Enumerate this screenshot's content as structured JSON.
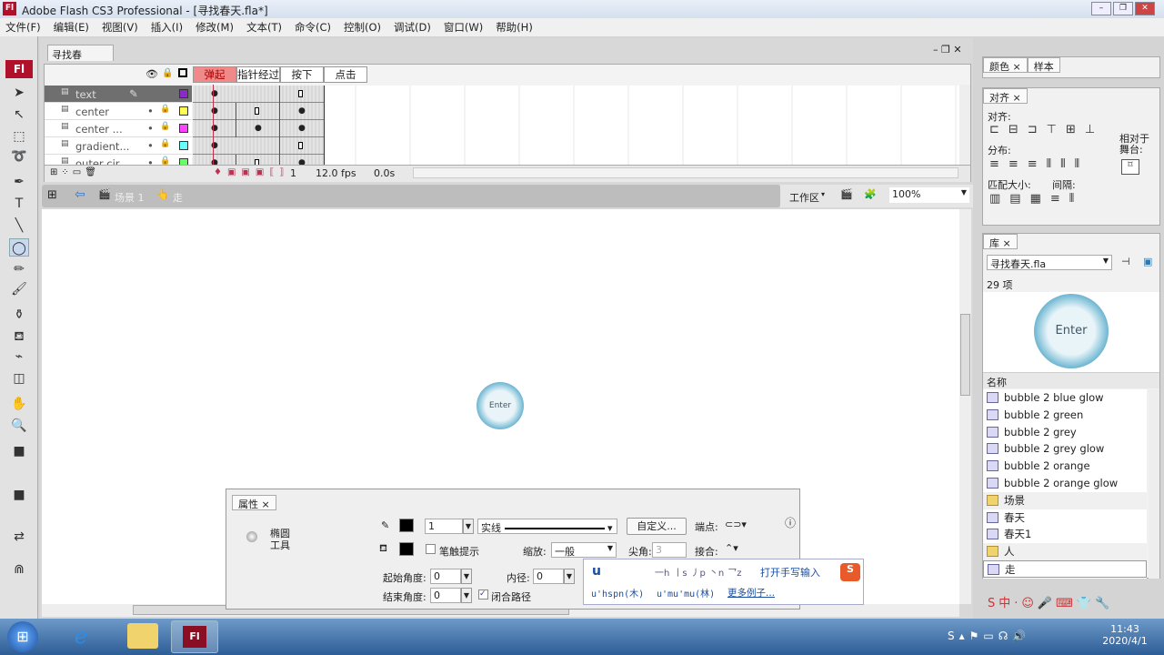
{
  "window": {
    "title": "Adobe Flash CS3 Professional - [寻找春天.fla*]",
    "logo": "Fl",
    "min": "–",
    "max": "❐",
    "close": "✕"
  },
  "menu": [
    "文件(F)",
    "编辑(E)",
    "视图(V)",
    "插入(I)",
    "修改(M)",
    "文本(T)",
    "命令(C)",
    "控制(O)",
    "调试(D)",
    "窗口(W)",
    "帮助(H)"
  ],
  "document": {
    "tab": "寻找春天.fla*"
  },
  "timeline": {
    "frame_labels": [
      "弹起",
      "指针经过",
      "按下",
      "点击"
    ],
    "layers": [
      {
        "name": "text",
        "color": "#8a2bc8"
      },
      {
        "name": "center",
        "color": "#ffff55"
      },
      {
        "name": "center ...",
        "color": "#ff44ff"
      },
      {
        "name": "gradient...",
        "color": "#66ffff"
      },
      {
        "name": "outer cir...",
        "color": "#66ff66"
      }
    ],
    "current_frame": "1",
    "fps": "12.0 fps",
    "time": "0.0s"
  },
  "editbar": {
    "scene": "场景 1",
    "symbol": "走",
    "workspace": "工作区",
    "zoom": "100%"
  },
  "stage": {
    "symbol_text": "Enter"
  },
  "panels": {
    "color": {
      "tabs": [
        "颜色",
        "样本"
      ]
    },
    "align": {
      "tab": "对齐",
      "align_label": "对齐:",
      "distribute_label": "分布:",
      "match_label": "匹配大小:",
      "space_label": "间隔:",
      "relative_label": "相对于舞台:"
    },
    "library": {
      "tab": "库",
      "file": "寻找春天.fla",
      "count": "29 项",
      "preview_text": "Enter",
      "column": "名称",
      "items": [
        {
          "name": "bubble 2 blue glow",
          "type": "symbol"
        },
        {
          "name": "bubble 2 green",
          "type": "button"
        },
        {
          "name": "bubble 2 grey",
          "type": "button"
        },
        {
          "name": "bubble 2 grey glow",
          "type": "button"
        },
        {
          "name": "bubble 2 orange",
          "type": "button"
        },
        {
          "name": "bubble 2 orange glow",
          "type": "symbol"
        },
        {
          "name": "场景",
          "type": "folder"
        },
        {
          "name": "春天",
          "type": "symbol"
        },
        {
          "name": "春天1",
          "type": "symbol"
        },
        {
          "name": "人",
          "type": "folder"
        },
        {
          "name": "走",
          "type": "button"
        }
      ]
    }
  },
  "properties": {
    "tab": "属性",
    "tool_name": "椭圆工具",
    "stroke_width": "1",
    "stroke_style": "实线",
    "custom_button": "自定义...",
    "cap_label": "端点:",
    "stroke_hint": "笔触提示",
    "scale_label": "缩放:",
    "scale_value": "一般",
    "miter_label": "尖角:",
    "miter_value": "3",
    "join_label": "接合:",
    "start_angle_label": "起始角度:",
    "start_angle": "0",
    "end_angle_label": "结束角度:",
    "end_angle": "0",
    "inner_radius_label": "内径:",
    "inner_radius": "0",
    "close_path": "闭合路径"
  },
  "ime": {
    "input": "u",
    "strokes": [
      "一h",
      "丨s",
      "丿p",
      "丶n",
      "乛z"
    ],
    "handwriting": "打开手写输入",
    "examples": [
      "u'hspn(木)",
      "u'mu'mu(林)"
    ],
    "more": "更多例子..."
  },
  "taskbar": {
    "time": "11:43",
    "date": "2020/4/1",
    "flash_label": "Fl"
  }
}
